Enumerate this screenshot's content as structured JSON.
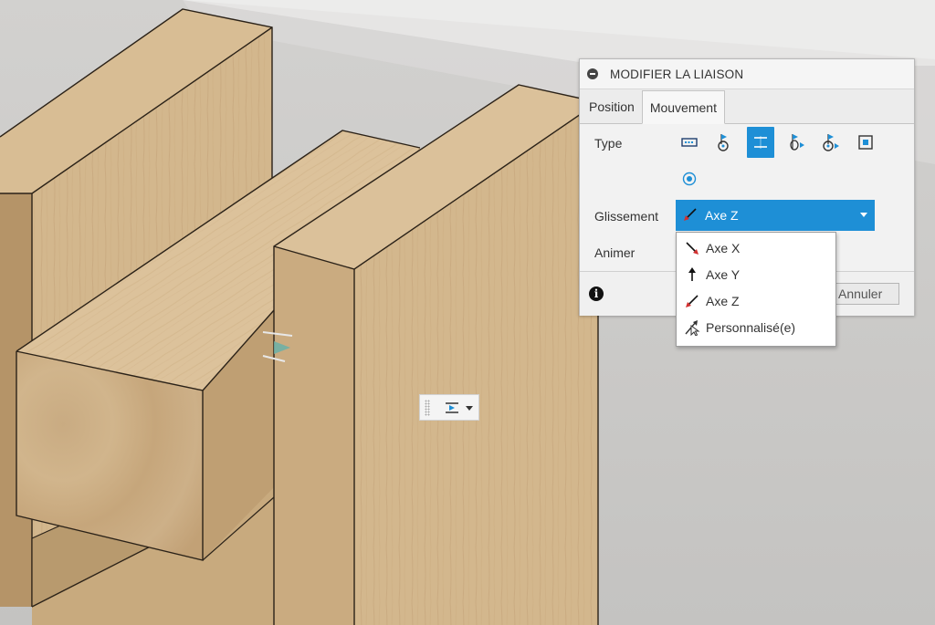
{
  "dialog": {
    "title": "MODIFIER LA LIAISON",
    "tabs": [
      {
        "label": "Position",
        "active": false
      },
      {
        "label": "Mouvement",
        "active": true
      }
    ],
    "type_label": "Type",
    "type_icons": [
      "rigid-joint-icon",
      "revolute-joint-icon",
      "slider-joint-icon",
      "cylindrical-joint-icon",
      "pin-slot-joint-icon",
      "planar-joint-icon",
      "ball-joint-icon"
    ],
    "selected_type": "slider-joint-icon",
    "slide_label": "Glissement",
    "slide_value": "Axe Z",
    "animate_label": "Animer",
    "cancel_label": "Annuler"
  },
  "menu": {
    "items": [
      {
        "label": "Axe X",
        "icon": "axis-x-icon"
      },
      {
        "label": "Axe Y",
        "icon": "axis-y-icon"
      },
      {
        "label": "Axe Z",
        "icon": "axis-z-icon"
      },
      {
        "label": "Personnalisé(e)",
        "icon": "custom-axis-icon"
      }
    ]
  },
  "colors": {
    "accent": "#1e8fd6",
    "wood_light": "#d9bf97",
    "wood_mid": "#c9ab7f",
    "wood_dark": "#b39064",
    "background": "#c9c8c6",
    "axis_red": "#d23030"
  }
}
